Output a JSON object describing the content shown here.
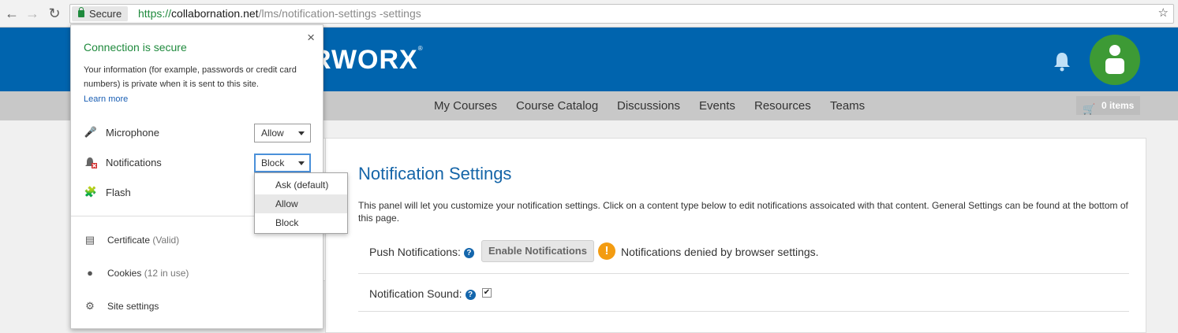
{
  "browser": {
    "secure_label": "Secure",
    "url_scheme": "https://",
    "url_host": "collabornation.net",
    "url_path": "/lms/notification-settings -settings",
    "icons": {
      "back": "arrow-left-icon",
      "forward": "arrow-right-icon",
      "reload": "reload-icon",
      "bookmark": "star-icon"
    }
  },
  "header": {
    "logo_text": "RWORX",
    "logo_mark": "®",
    "brand_color": "#0064ae",
    "avatar_color": "#3d9a35"
  },
  "nav": {
    "items": [
      "My Courses",
      "Course Catalog",
      "Discussions",
      "Events",
      "Resources",
      "Teams"
    ],
    "cart_label": "0 items"
  },
  "main": {
    "title": "Notification Settings",
    "description": "This panel will let you customize your notification settings. Click on a content type below to edit notifications assoicated with that content. General Settings can be found at the bottom of this page.",
    "push_label": "Push Notifications:",
    "enable_button": "Enable Notifications",
    "warning_text": "Notifications denied by browser settings.",
    "sound_label": "Notification Sound:",
    "sound_checked": "✔",
    "help_glyph": "?",
    "warning_glyph": "!"
  },
  "popup": {
    "close_glyph": "×",
    "title": "Connection is secure",
    "description": "Your information (for example, passwords or credit card numbers) is private when it is sent to this site.",
    "learn_more": "Learn more",
    "permissions": [
      {
        "label": "Microphone",
        "value": "Allow",
        "icon": "microphone-icon"
      },
      {
        "label": "Notifications",
        "value": "Block",
        "icon": "notifications-blocked-icon"
      },
      {
        "label": "Flash",
        "value": "",
        "icon": "puzzle-icon"
      }
    ],
    "items": [
      {
        "label": "Certificate",
        "sub": "(Valid)",
        "icon": "certificate-icon"
      },
      {
        "label": "Cookies",
        "sub": "(12 in use)",
        "icon": "cookie-icon"
      },
      {
        "label": "Site settings",
        "sub": "",
        "icon": "gear-icon"
      }
    ]
  },
  "dropdown": {
    "options": [
      "Ask (default)",
      "Allow",
      "Block"
    ],
    "hovered": "Allow"
  }
}
